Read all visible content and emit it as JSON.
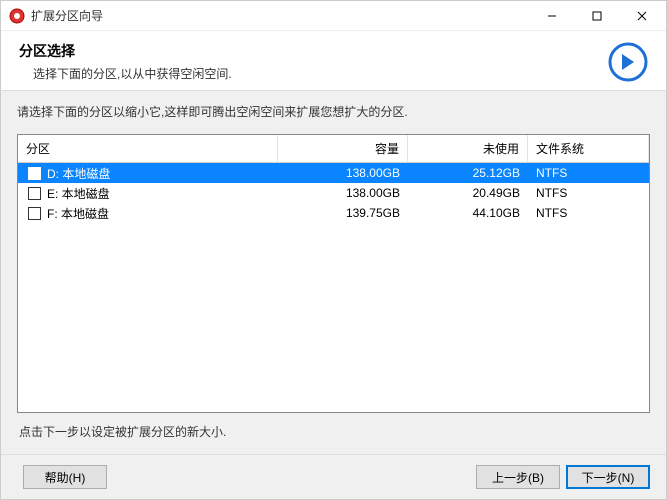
{
  "window": {
    "title": "扩展分区向导"
  },
  "header": {
    "heading": "分区选择",
    "subtitle": "选择下面的分区,以从中获得空闲空间."
  },
  "instruction": "请选择下面的分区以缩小它,这样即可腾出空闲空间来扩展您想扩大的分区.",
  "table": {
    "headers": {
      "partition": "分区",
      "capacity": "容量",
      "unused": "未使用",
      "fs": "文件系统"
    },
    "rows": [
      {
        "checked": true,
        "selected": true,
        "label": "D: 本地磁盘",
        "capacity": "138.00GB",
        "unused": "25.12GB",
        "fs": "NTFS"
      },
      {
        "checked": false,
        "selected": false,
        "label": "E: 本地磁盘",
        "capacity": "138.00GB",
        "unused": "20.49GB",
        "fs": "NTFS"
      },
      {
        "checked": false,
        "selected": false,
        "label": "F: 本地磁盘",
        "capacity": "139.75GB",
        "unused": "44.10GB",
        "fs": "NTFS"
      }
    ]
  },
  "hint": "点击下一步以设定被扩展分区的新大小.",
  "buttons": {
    "help": "帮助(H)",
    "back": "上一步(B)",
    "next": "下一步(N)"
  }
}
